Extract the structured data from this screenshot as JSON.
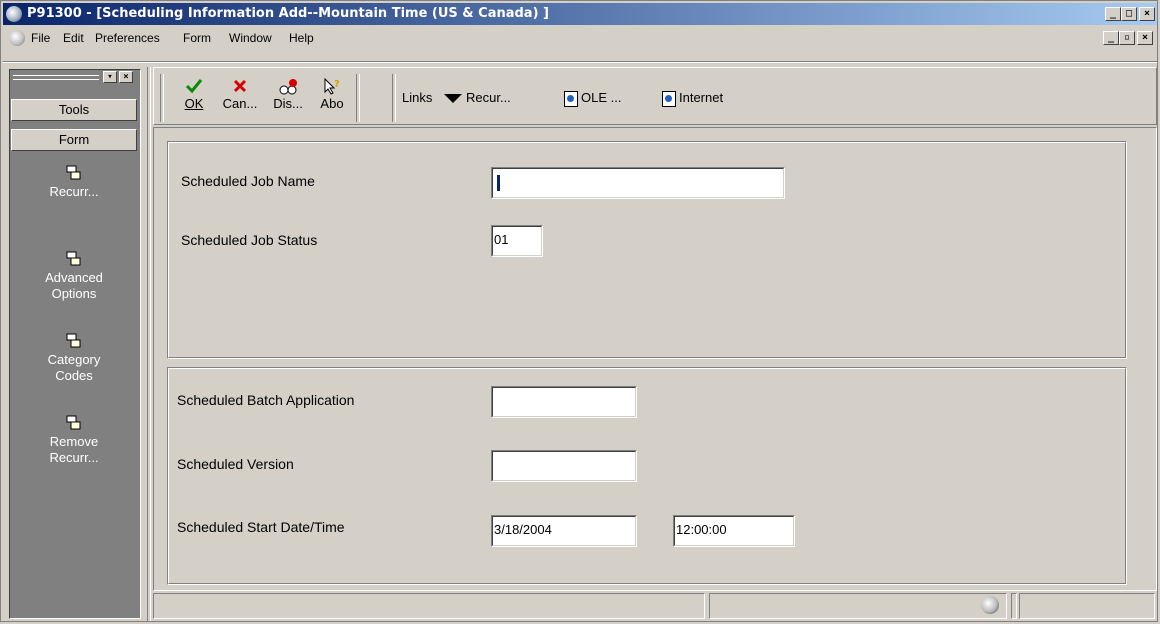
{
  "window": {
    "title": "P91300 - [Scheduling Information Add--Mountain Time (US & Canada)  ]"
  },
  "menu": {
    "items": [
      "File",
      "Edit",
      "Preferences",
      "Form",
      "Window",
      "Help"
    ]
  },
  "left_panel": {
    "tools_label": "Tools",
    "form_label": "Form",
    "items": [
      {
        "label": "Recurr...",
        "icon": "form-exit-icon"
      },
      {
        "label": "Advanced Options",
        "icon": "form-exit-icon"
      },
      {
        "label": "Category Codes",
        "icon": "form-exit-icon"
      },
      {
        "label": "Remove Recurr...",
        "icon": "form-exit-icon"
      }
    ]
  },
  "toolbar": {
    "ok": "OK",
    "cancel": "Can...",
    "display": "Dis...",
    "about": "Abo",
    "links": "Links",
    "recur": "Recur...",
    "ole": "OLE ...",
    "internet": "Internet"
  },
  "form": {
    "job_name_label": "Scheduled Job Name",
    "job_name_value": "",
    "job_status_label": "Scheduled Job Status",
    "job_status_value": "01",
    "batch_app_label": "Scheduled Batch Application",
    "batch_app_value": "",
    "version_label": "Scheduled Version",
    "version_value": "",
    "start_label": "Scheduled Start Date/Time",
    "start_date": "3/18/2004",
    "start_time": "12:00:00"
  },
  "colors": {
    "title_start": "#0a246a",
    "title_end": "#a6caf0",
    "face": "#d4d0c8",
    "left_panel_bg": "#808080"
  }
}
